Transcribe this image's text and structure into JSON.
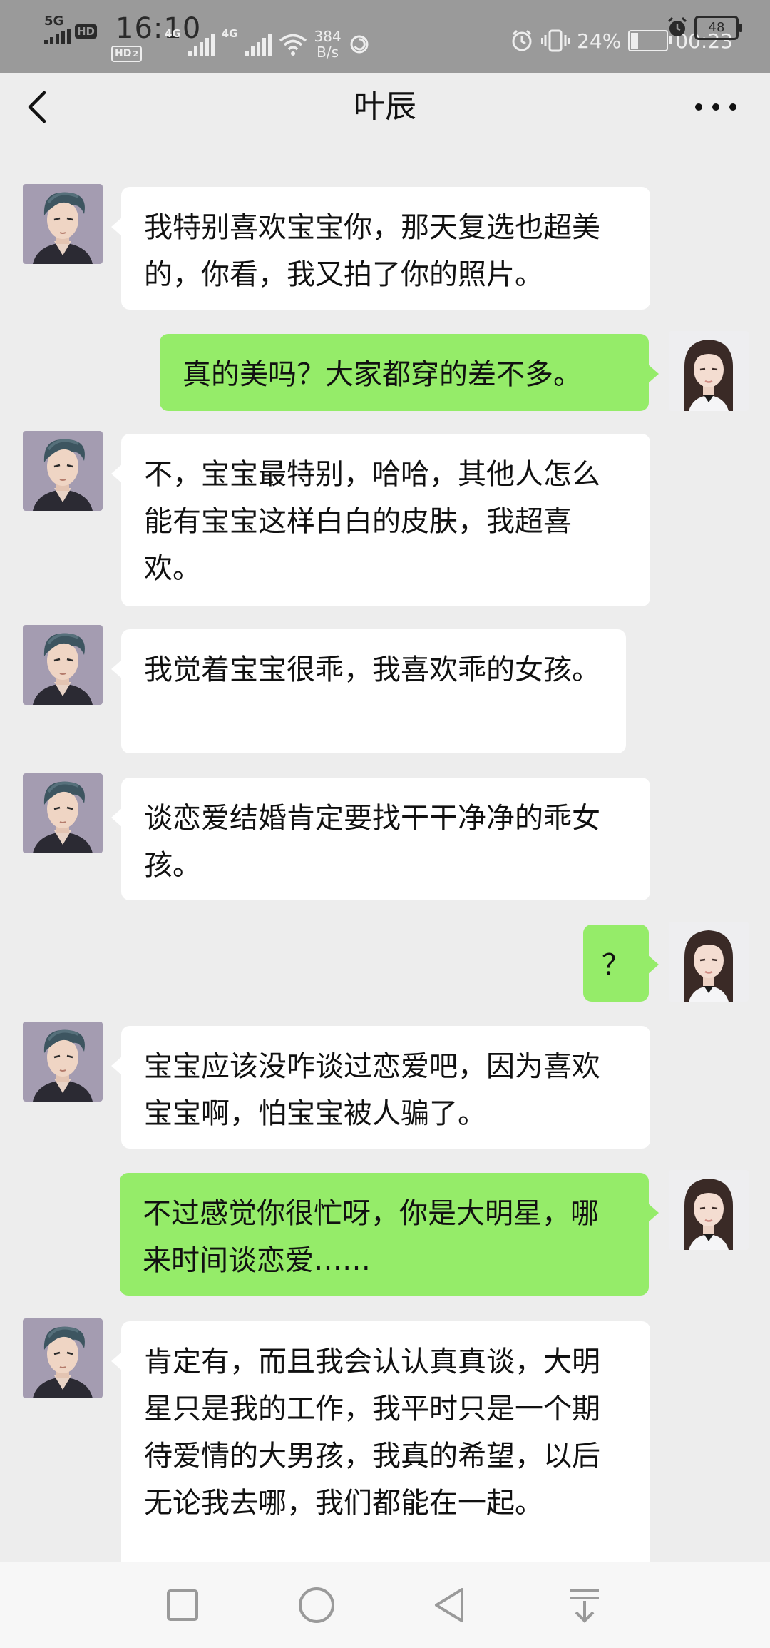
{
  "status_bar": {
    "network_label": "5G",
    "hd_label": "HD",
    "time": "16:10",
    "ghost_hd_label": "HD",
    "ghost_hd_sub": "2",
    "ghost_net_label_1": "4G",
    "ghost_net_label_2": "4G",
    "speed_value": "384",
    "speed_unit": "B/s",
    "battery_percent": "24%",
    "ghost_time": "00:23",
    "battery_level": "48"
  },
  "title_bar": {
    "title": "叶辰",
    "back_icon": "chevron-left-icon",
    "more_icon": "more-dots-icon"
  },
  "messages": [
    {
      "side": "left",
      "text": "我特别喜欢宝宝你，那天复选也超美的，你看，我又拍了你的照片。"
    },
    {
      "side": "right",
      "text": "真的美吗？大家都穿的差不多。"
    },
    {
      "side": "left",
      "text": "不，宝宝最特别，哈哈，其他人怎么能有宝宝这样白白的皮肤，我超喜欢。"
    },
    {
      "side": "left",
      "text": "我觉着宝宝很乖，我喜欢乖的女孩。"
    },
    {
      "side": "left",
      "text": "谈恋爱结婚肯定要找干干净净的乖女孩。"
    },
    {
      "side": "right",
      "text": "？"
    },
    {
      "side": "left",
      "text": "宝宝应该没咋谈过恋爱吧，因为喜欢宝宝啊，怕宝宝被人骗了。"
    },
    {
      "side": "right",
      "text": "不过感觉你很忙呀，你是大明星，哪来时间谈恋爱……"
    },
    {
      "side": "left",
      "text": "肯定有，而且我会认认真真谈，大明星只是我的工作，我平时只是一个期待爱情的大男孩，我真的希望，以后无论我去哪，我们都能在一起。"
    }
  ],
  "nav_bar": {
    "icons": [
      "square-recent-apps-icon",
      "circle-home-icon",
      "triangle-back-icon",
      "pull-down-icon"
    ]
  },
  "colors": {
    "status_bar_bg": "#9a9a9a",
    "chat_bg": "#ededed",
    "bubble_left": "#ffffff",
    "bubble_right": "#95ec69"
  }
}
